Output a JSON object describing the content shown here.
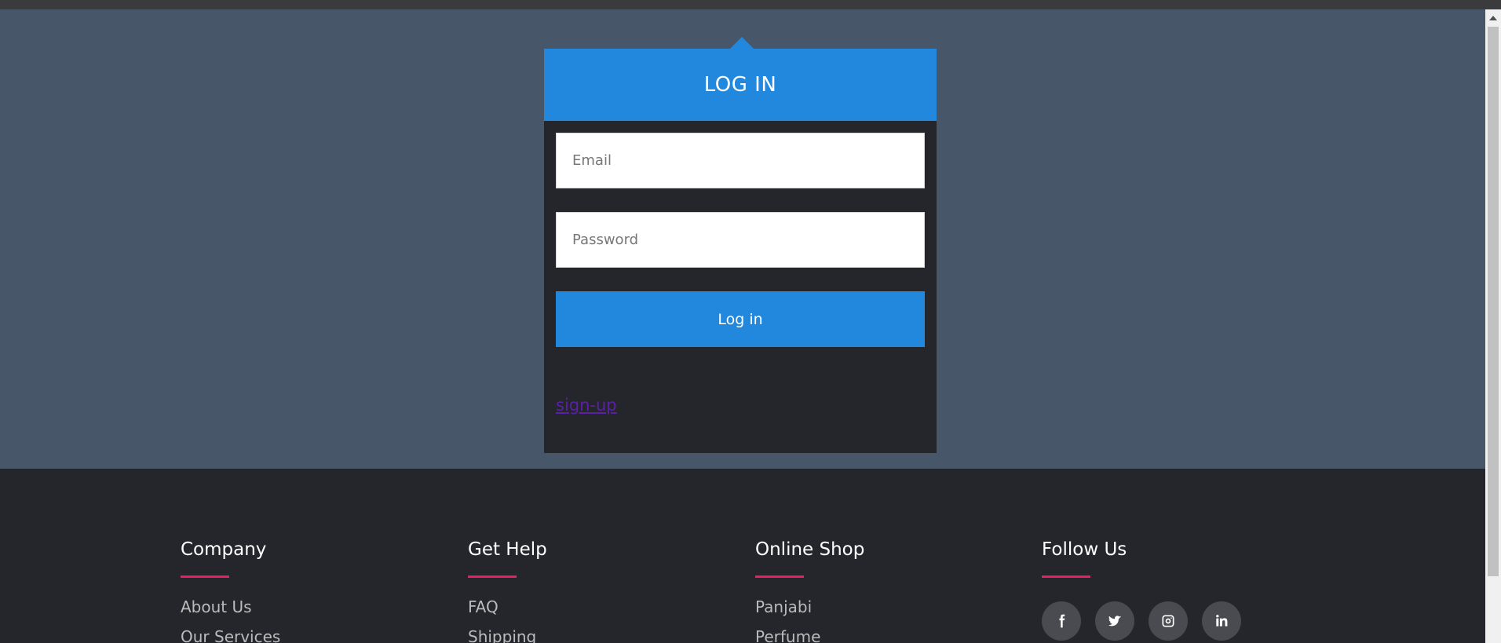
{
  "login": {
    "title": "LOG IN",
    "email_placeholder": "Email",
    "password_placeholder": "Password",
    "button_label": "Log in",
    "signup_link": "sign-up"
  },
  "footer": {
    "columns": [
      {
        "title": "Company",
        "links": [
          "About Us",
          "Our Services"
        ]
      },
      {
        "title": "Get Help",
        "links": [
          "FAQ",
          "Shipping"
        ]
      },
      {
        "title": "Online Shop",
        "links": [
          "Panjabi",
          "Perfume"
        ]
      },
      {
        "title": "Follow Us",
        "social": [
          "facebook-icon",
          "twitter-icon",
          "instagram-icon",
          "linkedin-icon"
        ]
      }
    ]
  },
  "colors": {
    "accent": "#2188dd",
    "hero_bg": "#475668",
    "dark_bg": "#24262b",
    "underline": "#e91e63"
  }
}
